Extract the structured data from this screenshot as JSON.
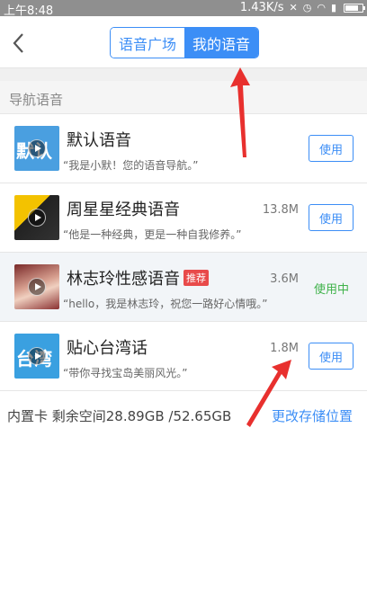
{
  "status_bar": {
    "time": "上午8:48",
    "speed": "1.43K/s"
  },
  "header": {
    "tabs": [
      {
        "label": "语音广场",
        "selected": false
      },
      {
        "label": "我的语音",
        "selected": true
      }
    ]
  },
  "section": {
    "title": "导航语音"
  },
  "voices": [
    {
      "name": "默认语音",
      "thumb_text": "默认",
      "desc": "“我是小默！您的语音导航。”",
      "size": "",
      "action": "使用"
    },
    {
      "name": "周星星经典语音",
      "desc": "“他是一种经典，更是一种自我修养。”",
      "size": "13.8M",
      "action": "使用"
    },
    {
      "name": "林志玲性感语音",
      "badge": "推荐",
      "desc": "“hello，我是林志玲，祝您一路好心情哦。”",
      "size": "3.6M",
      "status": "使用中"
    },
    {
      "name": "贴心台湾话",
      "thumb_text": "台湾",
      "desc": "“带你寻找宝岛美丽风光。”",
      "size": "1.8M",
      "action": "使用"
    }
  ],
  "storage": {
    "info": "内置卡 剩余空间28.89GB /52.65GB",
    "change_label": "更改存储位置"
  },
  "colors": {
    "accent": "#3c8ef6",
    "active_green": "#3fb24a",
    "badge_red": "#e84a4a",
    "arrow_red": "#e8302e"
  }
}
